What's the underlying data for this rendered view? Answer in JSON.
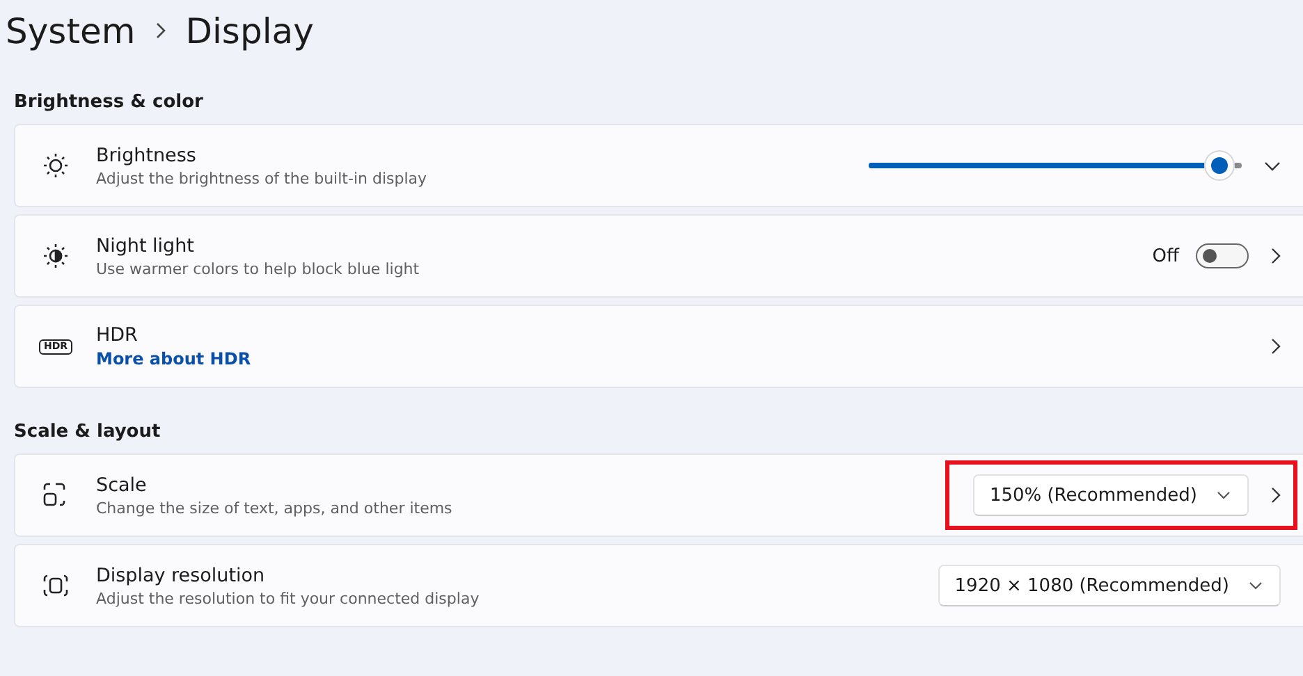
{
  "breadcrumb": {
    "parent": "System",
    "current": "Display"
  },
  "sections": [
    {
      "title": "Brightness & color",
      "rows": [
        {
          "kind": "slider",
          "title": "Brightness",
          "description": "Adjust the brightness of the built-in display",
          "level": 0.98,
          "highlighted": false
        },
        {
          "kind": "toggle",
          "title": "Night light",
          "description": "Use warmer colors to help block blue light",
          "state_text": "Off",
          "on": false,
          "highlighted": false
        },
        {
          "kind": "link",
          "icon_label": "HDR",
          "title": "HDR",
          "link": "More about HDR",
          "highlighted": false
        }
      ]
    },
    {
      "title": "Scale & layout",
      "rows": [
        {
          "kind": "dropdown",
          "title": "Scale",
          "description": "Change the size of text, apps, and other items",
          "value": "150% (Recommended)",
          "highlighted": true
        },
        {
          "kind": "dropdown",
          "title": "Display resolution",
          "description": "Adjust the resolution to fit your connected display",
          "value": "1920 × 1080 (Recommended)",
          "highlighted": false
        }
      ]
    }
  ]
}
